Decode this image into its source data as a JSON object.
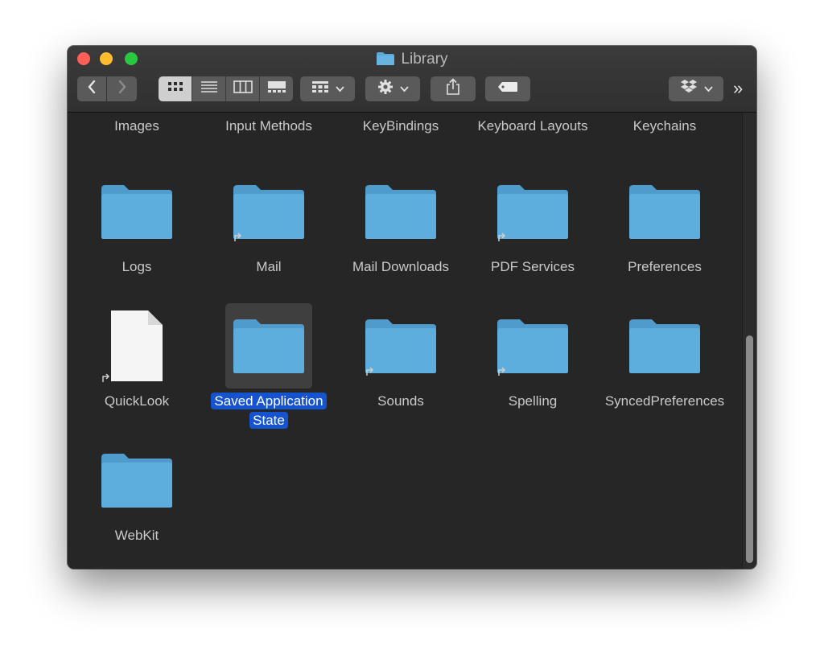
{
  "window": {
    "title": "Library"
  },
  "toolbar": {
    "more_label": "»"
  },
  "top_row_labels": [
    "Images",
    "Input Methods",
    "KeyBindings",
    "Keyboard Layouts",
    "Keychains"
  ],
  "items": [
    {
      "label": "Logs"
    },
    {
      "label": "Mail"
    },
    {
      "label": "Mail Downloads"
    },
    {
      "label": "PDF Services"
    },
    {
      "label": "Preferences"
    },
    {
      "label": "QuickLook"
    },
    {
      "label": "Saved Application State"
    },
    {
      "label": "Sounds"
    },
    {
      "label": "Spelling"
    },
    {
      "label": "SyncedPreferences"
    },
    {
      "label": "WebKit"
    }
  ],
  "colors": {
    "folder": "#5aa9da",
    "selection": "#1654cf"
  }
}
